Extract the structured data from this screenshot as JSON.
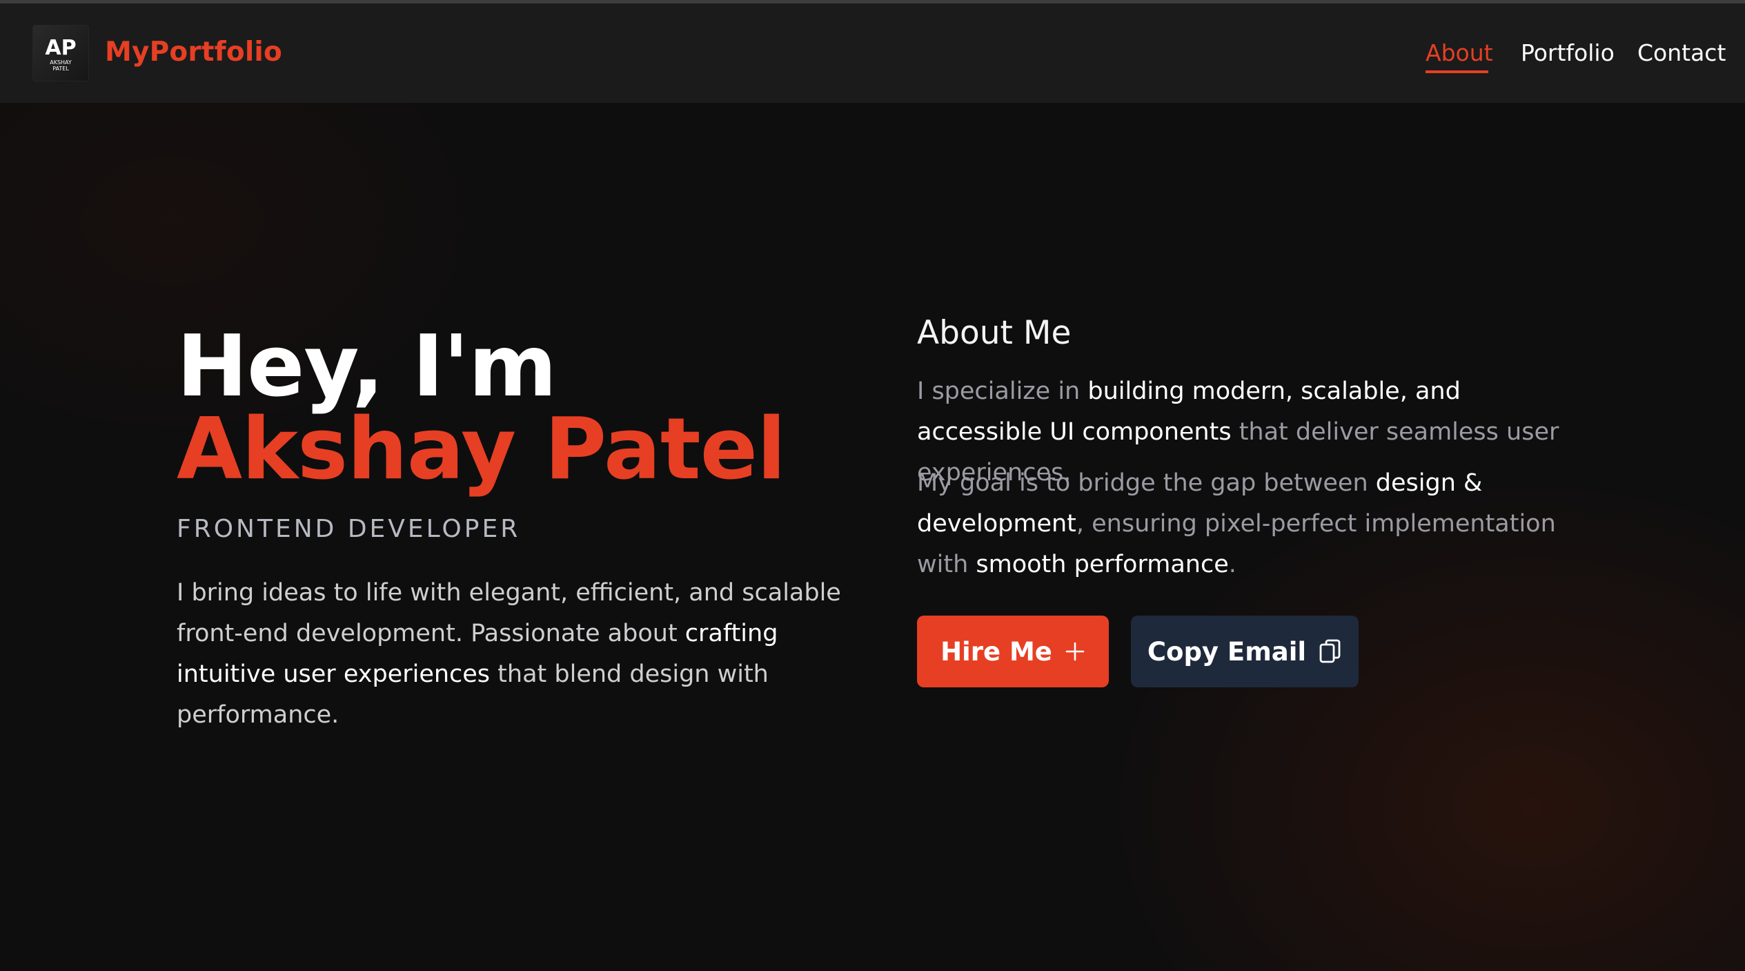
{
  "header": {
    "logo": {
      "initials": "AP",
      "line1": "AKSHAY",
      "line2": "PATEL"
    },
    "brand": "MyPortfolio",
    "nav": [
      {
        "label": "About",
        "active": true
      },
      {
        "label": "Portfolio",
        "active": false
      },
      {
        "label": "Contact",
        "active": false
      }
    ]
  },
  "hero": {
    "greeting": "Hey, I'm ",
    "name": "Akshay Patel",
    "role": "FRONTEND DEVELOPER",
    "description": {
      "part1": "I bring ideas to life with elegant, efficient, and scalable front-end development. Passionate about ",
      "highlight": "crafting intuitive user experiences",
      "part2": " that blend design with performance."
    }
  },
  "about": {
    "heading": "About Me",
    "p1": {
      "part1": "I specialize in ",
      "highlight": "building modern, scalable, and accessible UI components",
      "part2": " that deliver seamless user experiences."
    },
    "p2": {
      "part1": "My goal is to bridge the gap between ",
      "highlight1": "design & development",
      "part2": ", ensuring pixel-perfect implementation with ",
      "highlight2": "smooth performance",
      "part3": "."
    }
  },
  "buttons": {
    "hire": {
      "label": "Hire Me",
      "icon": "plus-icon"
    },
    "copy": {
      "label": "Copy Email",
      "icon": "copy-icon"
    }
  },
  "colors": {
    "accent": "#e63f24",
    "background": "#0e0e0e",
    "navbar": "#1b1b1b",
    "secondary_button": "#1e293b"
  }
}
